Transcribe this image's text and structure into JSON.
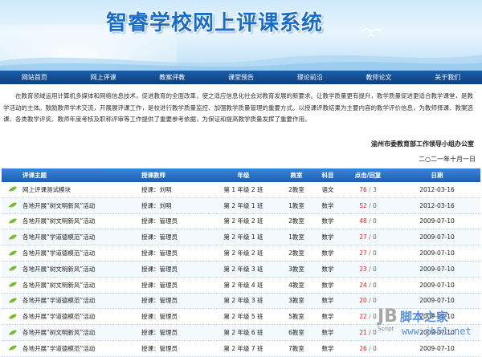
{
  "banner": {
    "title": "智睿学校网上评课系统"
  },
  "nav": {
    "items": [
      {
        "label": "网站首页"
      },
      {
        "label": "网上评课"
      },
      {
        "label": "教案评教"
      },
      {
        "label": "课堂预告"
      },
      {
        "label": "理论前沿"
      },
      {
        "label": "教师论文"
      },
      {
        "label": "关于我们"
      }
    ]
  },
  "intro": {
    "text": "在教育领域运用计算机多媒体和网络信息技术，促进教育的全面改革，使之适应信息化社会对教育发展的新要求。让教学质量更有提升，教学质量促进更适合教学课堂，是教学活动的主体。鼓励教师学术交流，开展展评课工作，是校进行教学质量监控、加强教学质量管理的重要方式。以授课评教结果为主要内容的教学评价信息，为教师择课、教案选课、各类教学评奖、教师年度考核及职称评审等工作提供了重要参考依据，为保证和提高教学质量发挥了重要作用。",
    "org": "渝州市委教育部工作领导小组办公室",
    "date": "二○二一年十月一日"
  },
  "table": {
    "headers": {
      "topic": "评课主题",
      "teacher": "授课教师",
      "grade": "年级",
      "room": "教室",
      "subject": "科目",
      "hits": "点击/回复",
      "date": "日期"
    },
    "rows": [
      {
        "topic": "网上评课测试模块",
        "teacher": "授课：刘明",
        "grade": "第 1 年级 2 班",
        "room": "2教室",
        "subject": "语文",
        "hits": "76",
        "replies": "3",
        "date": "2012-03-16"
      },
      {
        "topic": "各地开展“树文明新风”活动",
        "teacher": "授课：刘明",
        "grade": "第 2 年级 1 班",
        "room": "1教室",
        "subject": "数学",
        "hits": "52",
        "replies": "0",
        "date": "2012-03-16"
      },
      {
        "topic": "各地开展“树文明新风”活动",
        "teacher": "授课：管理员",
        "grade": "第 2 年级 2 班",
        "room": "2教室",
        "subject": "数学",
        "hits": "48",
        "replies": "0",
        "date": "2009-07-10"
      },
      {
        "topic": "各地开展“学道德模范”活动",
        "teacher": "授课：管理员",
        "grade": "第 2 年级 1 班",
        "room": "1教室",
        "subject": "数学",
        "hits": "27",
        "replies": "0",
        "date": "2009-07-10"
      },
      {
        "topic": "各地开展“学道德模范”活动",
        "teacher": "授课：管理员",
        "grade": "第 2 年级 2 班",
        "room": "2教室",
        "subject": "数学",
        "hits": "27",
        "replies": "0",
        "date": "2009-07-10"
      },
      {
        "topic": "各地开展“树文明新风”活动",
        "teacher": "授课：管理员",
        "grade": "第 2 年级 3 班",
        "room": "3教室",
        "subject": "数学",
        "hits": "23",
        "replies": "0",
        "date": "2009-07-10"
      },
      {
        "topic": "各地开展“树文明新风”活动",
        "teacher": "授课：管理员",
        "grade": "第 2 年级 4 班",
        "room": "4教室",
        "subject": "数学",
        "hits": "24",
        "replies": "0",
        "date": "2009-07-10"
      },
      {
        "topic": "各地开展“学道德模范”活动",
        "teacher": "授课：管理员",
        "grade": "第 2 年级 3 班",
        "room": "3教室",
        "subject": "数学",
        "hits": "20",
        "replies": "0",
        "date": "2009-07-10"
      },
      {
        "topic": "各地开展“学道德模范”活动",
        "teacher": "授课：管理员",
        "grade": "第 2 年级 5 班",
        "room": "5教室",
        "subject": "数学",
        "hits": "22",
        "replies": "0",
        "date": "2009-07-10"
      },
      {
        "topic": "各地开展“树文明新风”活动",
        "teacher": "授课：管理员",
        "grade": "第 2 年级 6 班",
        "room": "6教室",
        "subject": "数学",
        "hits": "21",
        "replies": "0",
        "date": "2009-07-10"
      },
      {
        "topic": "各地开展“学道德模范”活动",
        "teacher": "授课：管理员",
        "grade": "第 2 年级 7 班",
        "room": "7教室",
        "subject": "数学",
        "hits": "26",
        "replies": "0",
        "date": "2009-07-10"
      }
    ]
  },
  "watermark": {
    "logo": "JB",
    "brand": "脚本之家",
    "url": "www.jb51.net",
    "script": "Script"
  },
  "colors": {
    "nav_bg": "#0d3f80",
    "header_bg": "#1b5fb3",
    "title": "#1a6cc4",
    "hits": "#dd2222"
  },
  "icons": {
    "row_bullet": "leaf-icon",
    "banner_deco": "birds-icon"
  }
}
